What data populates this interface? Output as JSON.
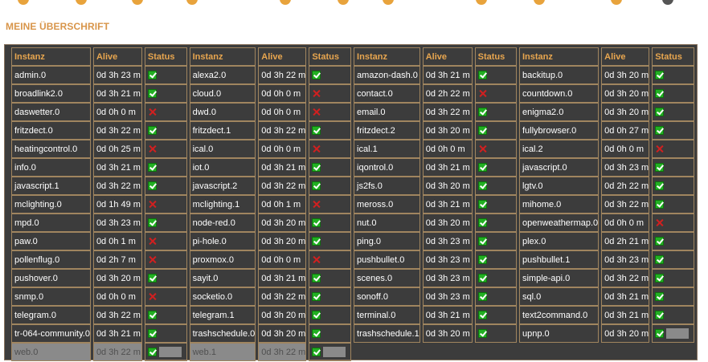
{
  "page": {
    "title": "MEINE ÜBERSCHRIFT"
  },
  "colors": {
    "accent": "#e8a64f",
    "ok": "#22b022",
    "fail": "#d02020",
    "panel": "#3c3c3c"
  },
  "headers": {
    "instance": "Instanz",
    "alive": "Alive",
    "status": "Status"
  },
  "rows": [
    [
      {
        "name": "admin.0",
        "alive": "0d 3h 23 m",
        "status": "ok"
      },
      {
        "name": "alexa2.0",
        "alive": "0d 3h 22 m",
        "status": "ok"
      },
      {
        "name": "amazon-dash.0",
        "alive": "0d 3h 21 m",
        "status": "ok"
      },
      {
        "name": "backitup.0",
        "alive": "0d 3h 20 m",
        "status": "ok"
      }
    ],
    [
      {
        "name": "broadlink2.0",
        "alive": "0d 3h 21 m",
        "status": "ok"
      },
      {
        "name": "cloud.0",
        "alive": "0d 0h 0 m",
        "status": "fail"
      },
      {
        "name": "contact.0",
        "alive": "0d 2h 22 m",
        "status": "fail"
      },
      {
        "name": "countdown.0",
        "alive": "0d 3h 20 m",
        "status": "ok"
      }
    ],
    [
      {
        "name": "daswetter.0",
        "alive": "0d 0h 0 m",
        "status": "fail"
      },
      {
        "name": "dwd.0",
        "alive": "0d 0h 0 m",
        "status": "fail"
      },
      {
        "name": "email.0",
        "alive": "0d 3h 22 m",
        "status": "ok"
      },
      {
        "name": "enigma2.0",
        "alive": "0d 3h 20 m",
        "status": "ok"
      }
    ],
    [
      {
        "name": "fritzdect.0",
        "alive": "0d 3h 22 m",
        "status": "ok"
      },
      {
        "name": "fritzdect.1",
        "alive": "0d 3h 22 m",
        "status": "ok"
      },
      {
        "name": "fritzdect.2",
        "alive": "0d 3h 20 m",
        "status": "ok"
      },
      {
        "name": "fullybrowser.0",
        "alive": "0d 0h 27 m",
        "status": "ok"
      }
    ],
    [
      {
        "name": "heatingcontrol.0",
        "alive": "0d 0h 25 m",
        "status": "fail"
      },
      {
        "name": "ical.0",
        "alive": "0d 0h 0 m",
        "status": "fail"
      },
      {
        "name": "ical.1",
        "alive": "0d 0h 0 m",
        "status": "fail"
      },
      {
        "name": "ical.2",
        "alive": "0d 0h 0 m",
        "status": "fail"
      }
    ],
    [
      {
        "name": "info.0",
        "alive": "0d 3h 21 m",
        "status": "ok"
      },
      {
        "name": "iot.0",
        "alive": "0d 3h 21 m",
        "status": "ok"
      },
      {
        "name": "iqontrol.0",
        "alive": "0d 3h 21 m",
        "status": "ok"
      },
      {
        "name": "javascript.0",
        "alive": "0d 3h 23 m",
        "status": "ok"
      }
    ],
    [
      {
        "name": "javascript.1",
        "alive": "0d 3h 22 m",
        "status": "ok"
      },
      {
        "name": "javascript.2",
        "alive": "0d 3h 22 m",
        "status": "ok"
      },
      {
        "name": "js2fs.0",
        "alive": "0d 3h 20 m",
        "status": "ok"
      },
      {
        "name": "lgtv.0",
        "alive": "0d 2h 22 m",
        "status": "ok"
      }
    ],
    [
      {
        "name": "mclighting.0",
        "alive": "0d 1h 49 m",
        "status": "fail"
      },
      {
        "name": "mclighting.1",
        "alive": "0d 0h 1 m",
        "status": "fail"
      },
      {
        "name": "meross.0",
        "alive": "0d 3h 21 m",
        "status": "ok"
      },
      {
        "name": "mihome.0",
        "alive": "0d 3h 22 m",
        "status": "ok"
      }
    ],
    [
      {
        "name": "mpd.0",
        "alive": "0d 3h 23 m",
        "status": "ok"
      },
      {
        "name": "node-red.0",
        "alive": "0d 3h 20 m",
        "status": "ok"
      },
      {
        "name": "nut.0",
        "alive": "0d 3h 20 m",
        "status": "ok"
      },
      {
        "name": "openweathermap.0",
        "alive": "0d 0h 0 m",
        "status": "fail"
      }
    ],
    [
      {
        "name": "paw.0",
        "alive": "0d 0h 1 m",
        "status": "fail"
      },
      {
        "name": "pi-hole.0",
        "alive": "0d 3h 20 m",
        "status": "ok"
      },
      {
        "name": "ping.0",
        "alive": "0d 3h 23 m",
        "status": "ok"
      },
      {
        "name": "plex.0",
        "alive": "0d 2h 21 m",
        "status": "ok"
      }
    ],
    [
      {
        "name": "pollenflug.0",
        "alive": "0d 2h 7 m",
        "status": "fail"
      },
      {
        "name": "proxmox.0",
        "alive": "0d 0h 0 m",
        "status": "fail"
      },
      {
        "name": "pushbullet.0",
        "alive": "0d 3h 23 m",
        "status": "ok"
      },
      {
        "name": "pushbullet.1",
        "alive": "0d 3h 23 m",
        "status": "ok"
      }
    ],
    [
      {
        "name": "pushover.0",
        "alive": "0d 3h 20 m",
        "status": "ok"
      },
      {
        "name": "sayit.0",
        "alive": "0d 3h 21 m",
        "status": "ok"
      },
      {
        "name": "scenes.0",
        "alive": "0d 3h 23 m",
        "status": "ok"
      },
      {
        "name": "simple-api.0",
        "alive": "0d 3h 22 m",
        "status": "ok"
      }
    ],
    [
      {
        "name": "snmp.0",
        "alive": "0d 0h 0 m",
        "status": "fail"
      },
      {
        "name": "socketio.0",
        "alive": "0d 3h 22 m",
        "status": "ok"
      },
      {
        "name": "sonoff.0",
        "alive": "0d 3h 23 m",
        "status": "ok"
      },
      {
        "name": "sql.0",
        "alive": "0d 3h 21 m",
        "status": "ok"
      }
    ],
    [
      {
        "name": "telegram.0",
        "alive": "0d 3h 22 m",
        "status": "ok"
      },
      {
        "name": "telegram.1",
        "alive": "0d 3h 20 m",
        "status": "ok"
      },
      {
        "name": "terminal.0",
        "alive": "0d 3h 21 m",
        "status": "ok"
      },
      {
        "name": "text2command.0",
        "alive": "0d 3h 21 m",
        "status": "ok"
      }
    ],
    [
      {
        "name": "tr-064-community.0",
        "alive": "0d 3h 21 m",
        "status": "ok"
      },
      {
        "name": "trashschedule.0",
        "alive": "0d 3h 20 m",
        "status": "ok"
      },
      {
        "name": "trashschedule.1",
        "alive": "0d 3h 20 m",
        "status": "ok"
      },
      {
        "name": "upnp.0",
        "alive": "0d 3h 20 m",
        "status": "ok",
        "dimAlive": true
      }
    ],
    [
      {
        "name": "web.0",
        "alive": "0d 3h 22 m",
        "status": "ok",
        "dim": true
      },
      {
        "name": "web.1",
        "alive": "0d 3h 22 m",
        "status": "ok",
        "dim": true
      }
    ]
  ]
}
